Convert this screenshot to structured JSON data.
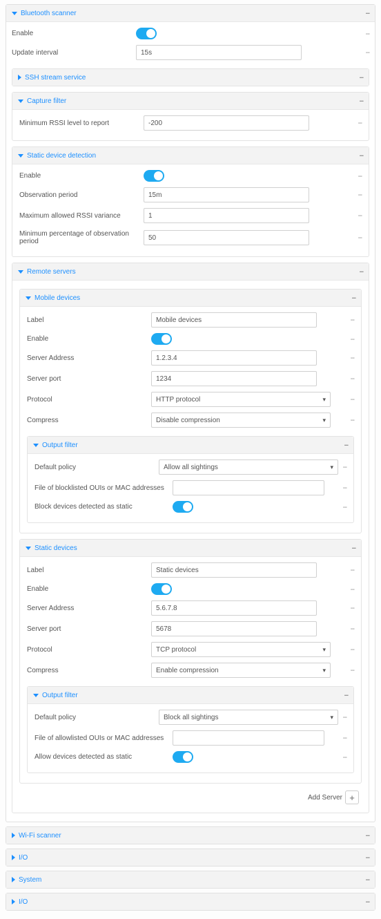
{
  "bluetooth": {
    "title": "Bluetooth scanner",
    "enable_label": "Enable",
    "update_interval_label": "Update interval",
    "update_interval_value": "15s"
  },
  "ssh": {
    "title": "SSH stream service"
  },
  "capture": {
    "title": "Capture filter",
    "min_rssi_label": "Minimum RSSI level to report",
    "min_rssi_value": "-200"
  },
  "static_detection": {
    "title": "Static device detection",
    "enable_label": "Enable",
    "obs_period_label": "Observation period",
    "obs_period_value": "15m",
    "max_rssi_var_label": "Maximum allowed RSSI variance",
    "max_rssi_var_value": "1",
    "min_pct_label": "Minimum percentage of observation period",
    "min_pct_value": "50"
  },
  "remote": {
    "title": "Remote servers",
    "add_server": "Add Server",
    "mobile": {
      "title": "Mobile devices",
      "label_label": "Label",
      "label_value": "Mobile devices",
      "enable_label": "Enable",
      "server_addr_label": "Server Address",
      "server_addr_value": "1.2.3.4",
      "server_port_label": "Server port",
      "server_port_value": "1234",
      "protocol_label": "Protocol",
      "protocol_value": "HTTP protocol",
      "compress_label": "Compress",
      "compress_value": "Disable compression",
      "filter": {
        "title": "Output filter",
        "default_policy_label": "Default policy",
        "default_policy_value": "Allow all sightings",
        "blocklist_label": "File of blocklisted OUIs or MAC addresses",
        "blocklist_value": "",
        "block_static_label": "Block devices detected as static"
      }
    },
    "static": {
      "title": "Static devices",
      "label_label": "Label",
      "label_value": "Static devices",
      "enable_label": "Enable",
      "server_addr_label": "Server Address",
      "server_addr_value": "5.6.7.8",
      "server_port_label": "Server port",
      "server_port_value": "5678",
      "protocol_label": "Protocol",
      "protocol_value": "TCP protocol",
      "compress_label": "Compress",
      "compress_value": "Enable compression",
      "filter": {
        "title": "Output filter",
        "default_policy_label": "Default policy",
        "default_policy_value": "Block all sightings",
        "allowlist_label": "File of allowlisted OUIs or MAC addresses",
        "allowlist_value": "",
        "allow_static_label": "Allow devices detected as static"
      }
    }
  },
  "wifi": {
    "title": "Wi-Fi scanner"
  },
  "io": {
    "title": "I/O"
  },
  "system": {
    "title": "System"
  },
  "io2": {
    "title": "I/O"
  }
}
